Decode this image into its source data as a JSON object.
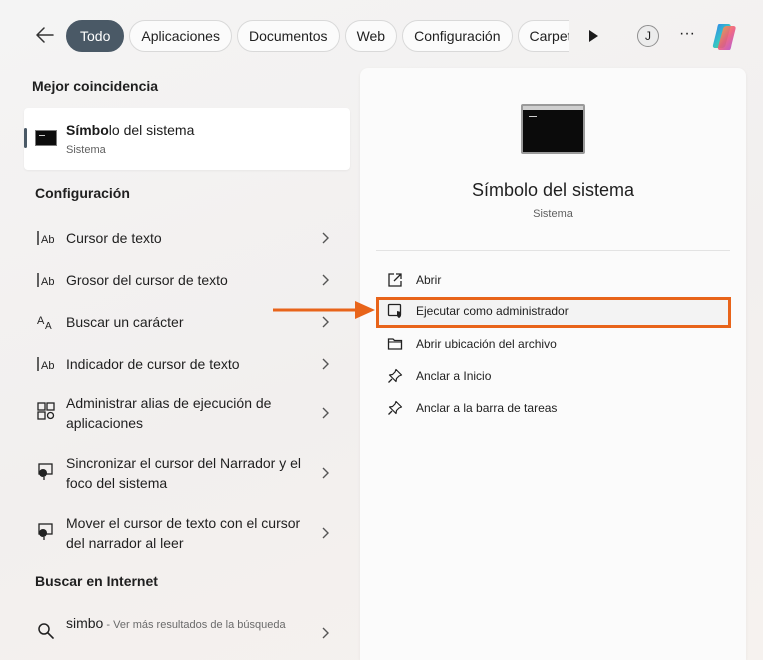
{
  "header": {
    "tabs": [
      {
        "label": "Todo",
        "active": true
      },
      {
        "label": "Aplicaciones"
      },
      {
        "label": "Documentos"
      },
      {
        "label": "Web"
      },
      {
        "label": "Configuración"
      },
      {
        "label": "Carpetas"
      }
    ],
    "avatar_initial": "J",
    "more_label": "···"
  },
  "best_match": {
    "section_title": "Mejor coincidencia",
    "title_bold": "Símbo",
    "title_rest": "lo del sistema",
    "subtitle": "Sistema"
  },
  "settings": {
    "section_title": "Configuración",
    "items": [
      {
        "label": "Cursor de texto",
        "icon": "text-cursor-icon"
      },
      {
        "label": "Grosor del cursor de texto",
        "icon": "text-cursor-icon"
      },
      {
        "label": "Buscar un carácter",
        "icon": "character-icon"
      },
      {
        "label": "Indicador de cursor de texto",
        "icon": "text-cursor-icon"
      },
      {
        "label": "Administrar alias de ejecución de aplicaciones",
        "icon": "app-alias-icon"
      },
      {
        "label": "Sincronizar el cursor del Narrador y el foco del sistema",
        "icon": "narrator-icon"
      },
      {
        "label": "Mover el cursor de texto con el cursor del narrador al leer",
        "icon": "narrator-icon"
      }
    ]
  },
  "web": {
    "section_title": "Buscar en Internet",
    "query": "simbo",
    "hint": " - Ver más resultados de la búsqueda"
  },
  "detail": {
    "app_name": "Símbolo del sistema",
    "app_type": "Sistema",
    "actions": [
      {
        "label": "Abrir",
        "icon": "open-icon"
      },
      {
        "label": "Ejecutar como administrador",
        "icon": "shield-icon",
        "highlighted": true
      },
      {
        "label": "Abrir ubicación del archivo",
        "icon": "folder-icon"
      },
      {
        "label": "Anclar a Inicio",
        "icon": "pin-icon"
      },
      {
        "label": "Anclar a la barra de tareas",
        "icon": "pin-icon"
      }
    ]
  },
  "colors": {
    "accent": "#4a5966",
    "highlight": "#e8641a"
  }
}
